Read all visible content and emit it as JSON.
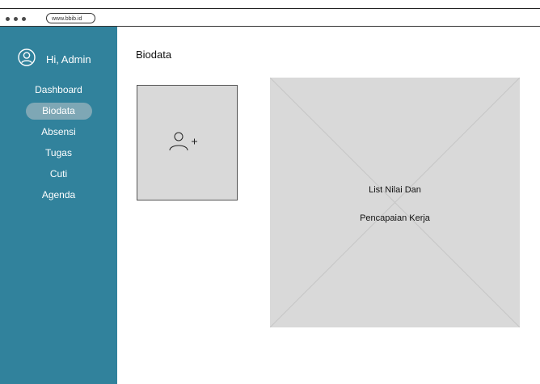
{
  "browser": {
    "url": "www.bbib.id"
  },
  "sidebar": {
    "greeting": "Hi, Admin",
    "items": [
      {
        "label": "Dashboard",
        "active": false
      },
      {
        "label": "Biodata",
        "active": true
      },
      {
        "label": "Absensi",
        "active": false
      },
      {
        "label": "Tugas",
        "active": false
      },
      {
        "label": "Cuti",
        "active": false
      },
      {
        "label": "Agenda",
        "active": false
      }
    ]
  },
  "main": {
    "title": "Biodata",
    "placeholder": {
      "line1": "List Nilai Dan",
      "line2": "Pencapaian Kerja"
    }
  },
  "colors": {
    "sidebar": "#31829c",
    "active_item": "#7ea7b5",
    "placeholder": "#d9d9d9"
  },
  "icons": {
    "user": "user-circle-icon",
    "add_user": "add-user-icon"
  }
}
